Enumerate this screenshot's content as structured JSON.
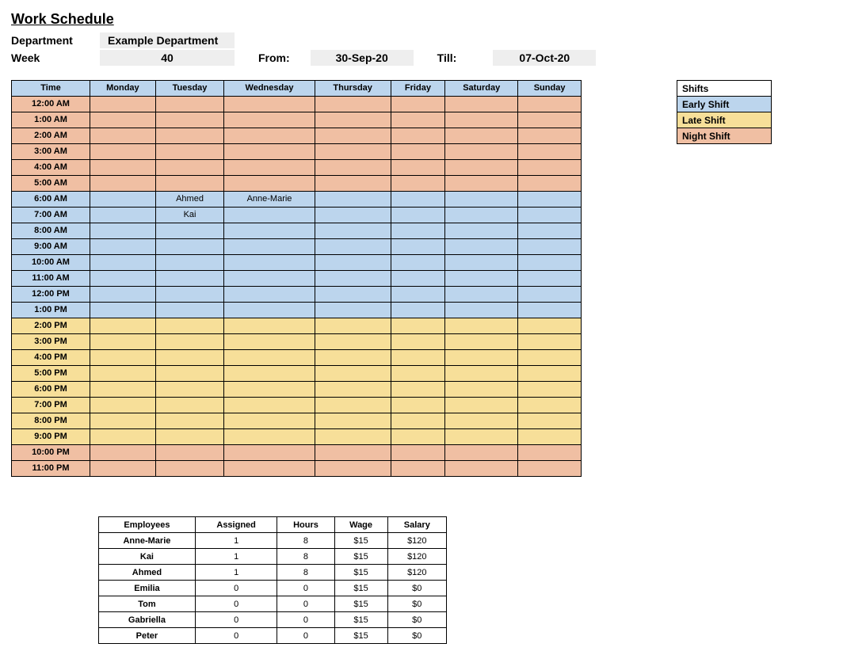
{
  "title": "Work Schedule",
  "meta": {
    "department_label": "Department",
    "department_value": "Example Department",
    "week_label": "Week",
    "week_value": "40",
    "from_label": "From:",
    "from_value": "30-Sep-20",
    "till_label": "Till:",
    "till_value": "07-Oct-20"
  },
  "schedule": {
    "headers": [
      "Time",
      "Monday",
      "Tuesday",
      "Wednesday",
      "Thursday",
      "Friday",
      "Saturday",
      "Sunday"
    ],
    "rows": [
      {
        "time": "12:00 AM",
        "shift": "night",
        "cells": [
          "",
          "",
          "",
          "",
          "",
          "",
          ""
        ]
      },
      {
        "time": "1:00 AM",
        "shift": "night",
        "cells": [
          "",
          "",
          "",
          "",
          "",
          "",
          ""
        ]
      },
      {
        "time": "2:00 AM",
        "shift": "night",
        "cells": [
          "",
          "",
          "",
          "",
          "",
          "",
          ""
        ]
      },
      {
        "time": "3:00 AM",
        "shift": "night",
        "cells": [
          "",
          "",
          "",
          "",
          "",
          "",
          ""
        ]
      },
      {
        "time": "4:00 AM",
        "shift": "night",
        "cells": [
          "",
          "",
          "",
          "",
          "",
          "",
          ""
        ]
      },
      {
        "time": "5:00 AM",
        "shift": "night",
        "cells": [
          "",
          "",
          "",
          "",
          "",
          "",
          ""
        ]
      },
      {
        "time": "6:00 AM",
        "shift": "early",
        "cells": [
          "",
          "Ahmed",
          "Anne-Marie",
          "",
          "",
          "",
          ""
        ]
      },
      {
        "time": "7:00 AM",
        "shift": "early",
        "cells": [
          "",
          "Kai",
          "",
          "",
          "",
          "",
          ""
        ]
      },
      {
        "time": "8:00 AM",
        "shift": "early",
        "cells": [
          "",
          "",
          "",
          "",
          "",
          "",
          ""
        ]
      },
      {
        "time": "9:00 AM",
        "shift": "early",
        "cells": [
          "",
          "",
          "",
          "",
          "",
          "",
          ""
        ]
      },
      {
        "time": "10:00 AM",
        "shift": "early",
        "cells": [
          "",
          "",
          "",
          "",
          "",
          "",
          ""
        ]
      },
      {
        "time": "11:00 AM",
        "shift": "early",
        "cells": [
          "",
          "",
          "",
          "",
          "",
          "",
          ""
        ]
      },
      {
        "time": "12:00 PM",
        "shift": "early",
        "cells": [
          "",
          "",
          "",
          "",
          "",
          "",
          ""
        ]
      },
      {
        "time": "1:00 PM",
        "shift": "early",
        "cells": [
          "",
          "",
          "",
          "",
          "",
          "",
          ""
        ]
      },
      {
        "time": "2:00 PM",
        "shift": "late",
        "cells": [
          "",
          "",
          "",
          "",
          "",
          "",
          ""
        ]
      },
      {
        "time": "3:00 PM",
        "shift": "late",
        "cells": [
          "",
          "",
          "",
          "",
          "",
          "",
          ""
        ]
      },
      {
        "time": "4:00 PM",
        "shift": "late",
        "cells": [
          "",
          "",
          "",
          "",
          "",
          "",
          ""
        ]
      },
      {
        "time": "5:00 PM",
        "shift": "late",
        "cells": [
          "",
          "",
          "",
          "",
          "",
          "",
          ""
        ]
      },
      {
        "time": "6:00 PM",
        "shift": "late",
        "cells": [
          "",
          "",
          "",
          "",
          "",
          "",
          ""
        ]
      },
      {
        "time": "7:00 PM",
        "shift": "late",
        "cells": [
          "",
          "",
          "",
          "",
          "",
          "",
          ""
        ]
      },
      {
        "time": "8:00 PM",
        "shift": "late",
        "cells": [
          "",
          "",
          "",
          "",
          "",
          "",
          ""
        ]
      },
      {
        "time": "9:00 PM",
        "shift": "late",
        "cells": [
          "",
          "",
          "",
          "",
          "",
          "",
          ""
        ]
      },
      {
        "time": "10:00 PM",
        "shift": "night",
        "cells": [
          "",
          "",
          "",
          "",
          "",
          "",
          ""
        ]
      },
      {
        "time": "11:00 PM",
        "shift": "night",
        "cells": [
          "",
          "",
          "",
          "",
          "",
          "",
          ""
        ]
      }
    ]
  },
  "legend": {
    "title": "Shifts",
    "items": [
      {
        "label": "Early Shift",
        "class": "early"
      },
      {
        "label": "Late Shift",
        "class": "late"
      },
      {
        "label": "Night Shift",
        "class": "night"
      }
    ]
  },
  "employees": {
    "headers": [
      "Employees",
      "Assigned",
      "Hours",
      "Wage",
      "Salary"
    ],
    "rows": [
      {
        "name": "Anne-Marie",
        "assigned": "1",
        "hours": "8",
        "wage": "$15",
        "salary": "$120"
      },
      {
        "name": "Kai",
        "assigned": "1",
        "hours": "8",
        "wage": "$15",
        "salary": "$120"
      },
      {
        "name": "Ahmed",
        "assigned": "1",
        "hours": "8",
        "wage": "$15",
        "salary": "$120"
      },
      {
        "name": "Emilia",
        "assigned": "0",
        "hours": "0",
        "wage": "$15",
        "salary": "$0"
      },
      {
        "name": "Tom",
        "assigned": "0",
        "hours": "0",
        "wage": "$15",
        "salary": "$0"
      },
      {
        "name": "Gabriella",
        "assigned": "0",
        "hours": "0",
        "wage": "$15",
        "salary": "$0"
      },
      {
        "name": "Peter",
        "assigned": "0",
        "hours": "0",
        "wage": "$15",
        "salary": "$0"
      }
    ]
  }
}
